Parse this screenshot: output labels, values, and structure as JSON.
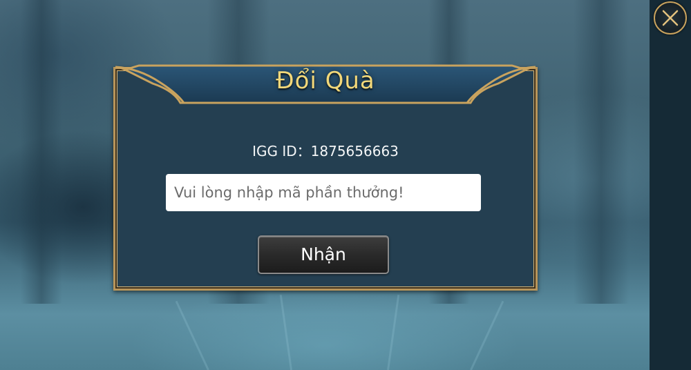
{
  "dialog": {
    "title": "Đổi Quà",
    "igg_label": "IGG ID：",
    "igg_value": "1875656663",
    "code_input": {
      "value": "",
      "placeholder": "Vui lòng nhập mã phần thưởng!"
    },
    "submit_label": "Nhận"
  },
  "icons": {
    "close": "close-icon"
  },
  "colors": {
    "panel_bg": "#243f51",
    "frame_gold": "#b8955a",
    "title_gold": "#f2d87a",
    "button_dark": "#2a2a2a",
    "sidebar": "#152a36"
  }
}
